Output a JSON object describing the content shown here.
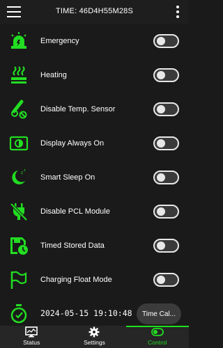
{
  "header": {
    "title": "TIME: 46D4H55M28S"
  },
  "toggles": [
    {
      "label": "Emergency",
      "icon": "siren-icon",
      "on": false
    },
    {
      "label": "Heating",
      "icon": "heating-icon",
      "on": false
    },
    {
      "label": "Disable Temp. Sensor",
      "icon": "thermometer-off-icon",
      "on": false
    },
    {
      "label": "Display Always On",
      "icon": "display-brightness-icon",
      "on": false
    },
    {
      "label": "Smart Sleep On",
      "icon": "moon-sleep-icon",
      "on": false
    },
    {
      "label": "Disable PCL Module",
      "icon": "plug-off-icon",
      "on": false
    },
    {
      "label": "Timed Stored Data",
      "icon": "save-clock-icon",
      "on": false
    },
    {
      "label": "Charging Float Mode",
      "icon": "flag-icon",
      "on": false
    }
  ],
  "datetime": {
    "value": "2024-05-15 19:10:48",
    "button": "Time Cal..."
  },
  "tabs": [
    {
      "label": "Status",
      "icon": "monitor-chart-icon",
      "active": false
    },
    {
      "label": "Settings",
      "icon": "gear-icon",
      "active": false
    },
    {
      "label": "Control",
      "icon": "toggle-icon",
      "active": true
    }
  ],
  "colors": {
    "accent": "#22dd22",
    "background": "#1a1a1a",
    "bar": "#262626"
  }
}
